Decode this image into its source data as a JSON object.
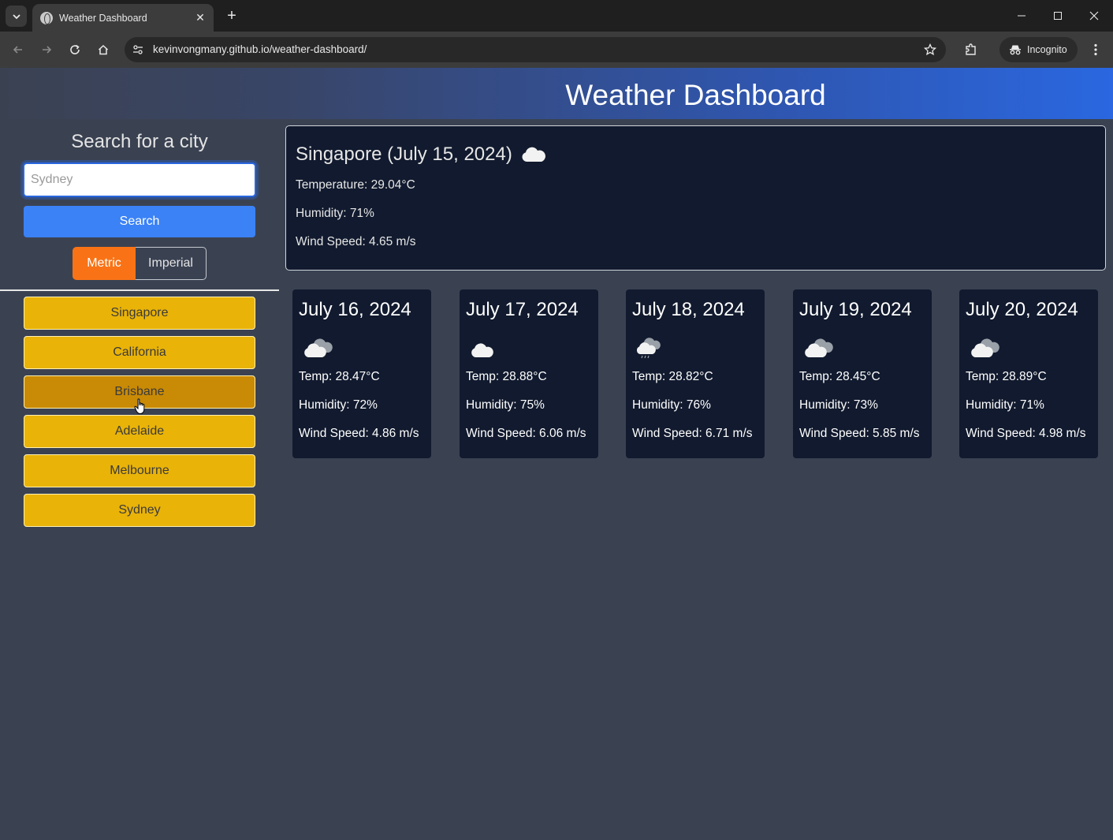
{
  "browser": {
    "tab_title": "Weather Dashboard",
    "url": "kevinvongmany.github.io/weather-dashboard/",
    "incognito_label": "Incognito"
  },
  "header": {
    "title": "Weather Dashboard"
  },
  "sidebar": {
    "title": "Search for a city",
    "search_placeholder": "Sydney",
    "search_button": "Search",
    "units": {
      "metric": "Metric",
      "imperial": "Imperial",
      "selected": "Metric"
    },
    "history": [
      "Singapore",
      "California",
      "Brisbane",
      "Adelaide",
      "Melbourne",
      "Sydney"
    ],
    "hovered": "Brisbane"
  },
  "current": {
    "heading": "Singapore (July 15, 2024)",
    "icon": "cloud-icon",
    "temperature": "Temperature: 29.04°C",
    "humidity": "Humidity: 71%",
    "wind": "Wind Speed: 4.65 m/s"
  },
  "forecast": [
    {
      "date": "July 16, 2024",
      "icon": "broken-clouds-icon",
      "temp": "Temp: 28.47°C",
      "humidity": "Humidity: 72%",
      "wind": "Wind Speed: 4.86 m/s"
    },
    {
      "date": "July 17, 2024",
      "icon": "cloud-icon",
      "temp": "Temp: 28.88°C",
      "humidity": "Humidity: 75%",
      "wind": "Wind Speed: 6.06 m/s"
    },
    {
      "date": "July 18, 2024",
      "icon": "light-rain-icon",
      "temp": "Temp: 28.82°C",
      "humidity": "Humidity: 76%",
      "wind": "Wind Speed: 6.71 m/s"
    },
    {
      "date": "July 19, 2024",
      "icon": "broken-clouds-icon",
      "temp": "Temp: 28.45°C",
      "humidity": "Humidity: 73%",
      "wind": "Wind Speed: 5.85 m/s"
    },
    {
      "date": "July 20, 2024",
      "icon": "broken-clouds-icon",
      "temp": "Temp: 28.89°C",
      "humidity": "Humidity: 71%",
      "wind": "Wind Speed: 4.98 m/s"
    }
  ],
  "colors": {
    "header_accent": "#2a67e0",
    "search_button": "#3b82f6",
    "metric_active": "#f97316",
    "history_button": "#e9b308",
    "history_button_hover": "#c98a05",
    "card_bg": "#111a2e",
    "page_bg": "#3a4252"
  }
}
